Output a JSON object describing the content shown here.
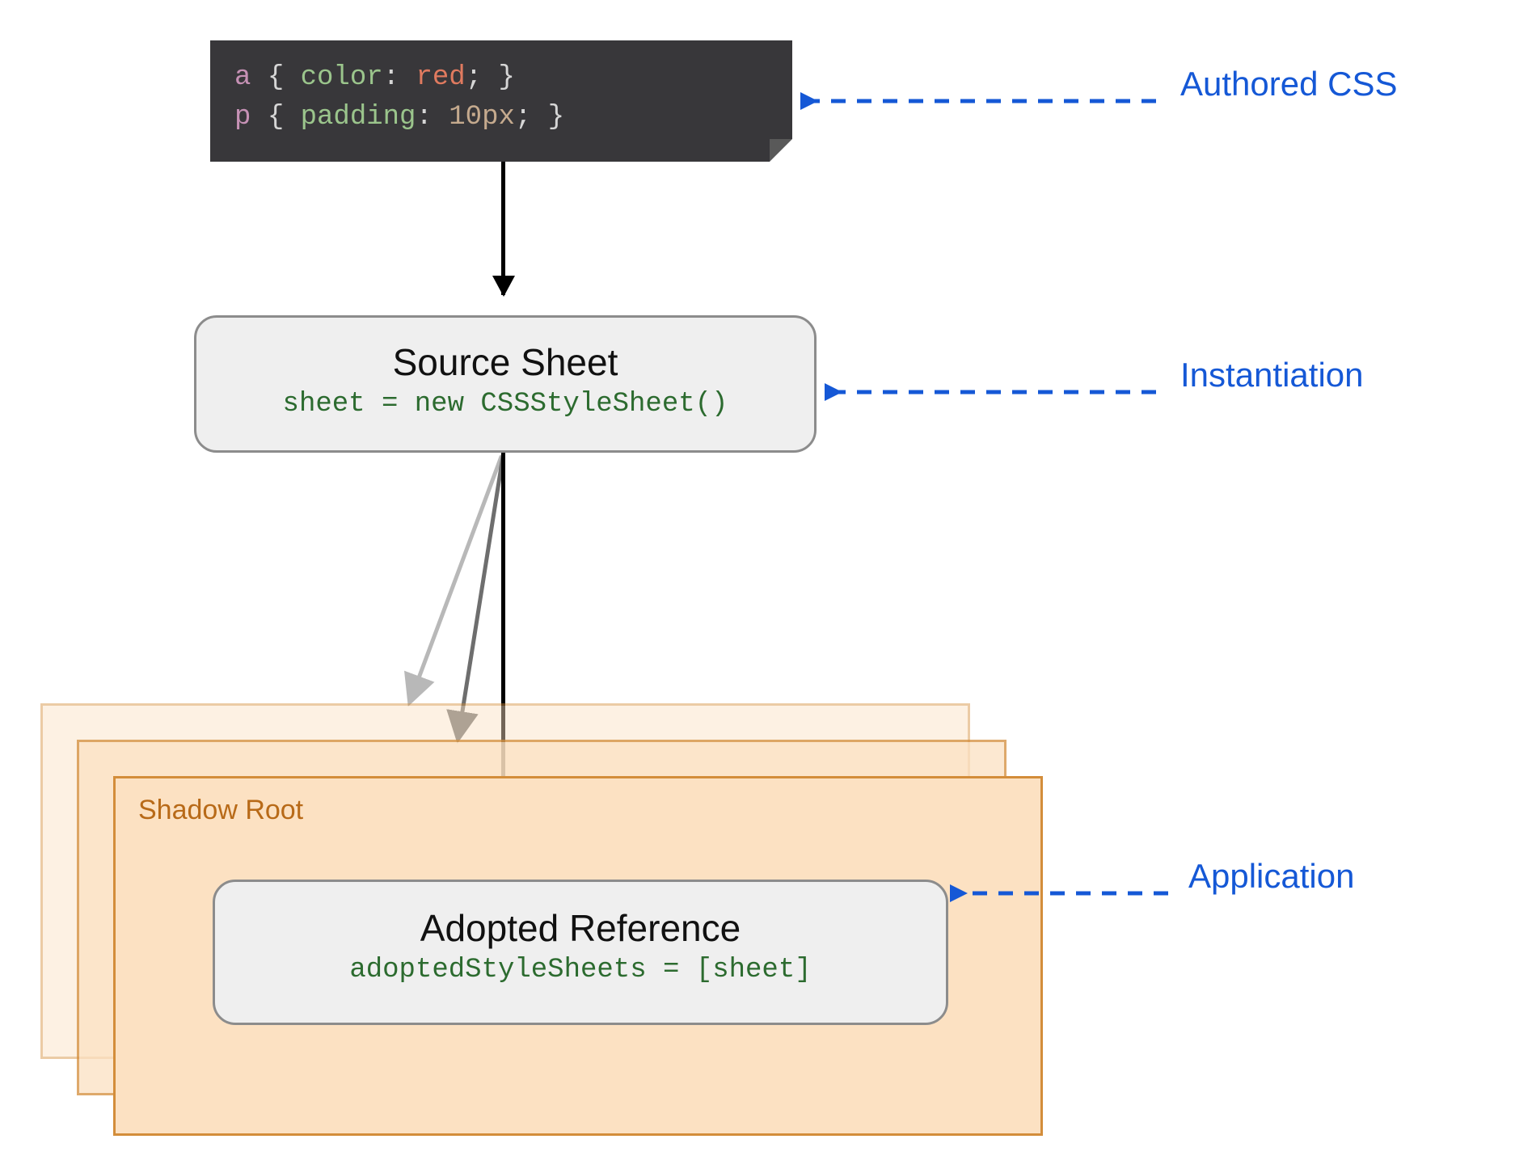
{
  "code": {
    "line1": {
      "sel": "a",
      "b1": "{",
      "prop": "color",
      "colon": ":",
      "val": "red",
      "semi": ";",
      "b2": "}"
    },
    "line2": {
      "sel": "p",
      "b1": "{",
      "prop": "padding",
      "colon": ":",
      "val": "10px",
      "semi": ";",
      "b2": "}"
    }
  },
  "source_sheet": {
    "title": "Source Sheet",
    "code": "sheet = new CSSStyleSheet()"
  },
  "shadow_root": {
    "label": "Shadow Root"
  },
  "adopted_ref": {
    "title": "Adopted Reference",
    "code": "adoptedStyleSheets = [sheet]"
  },
  "annotations": {
    "authored_css": "Authored CSS",
    "instantiation": "Instantiation",
    "application": "Application"
  }
}
